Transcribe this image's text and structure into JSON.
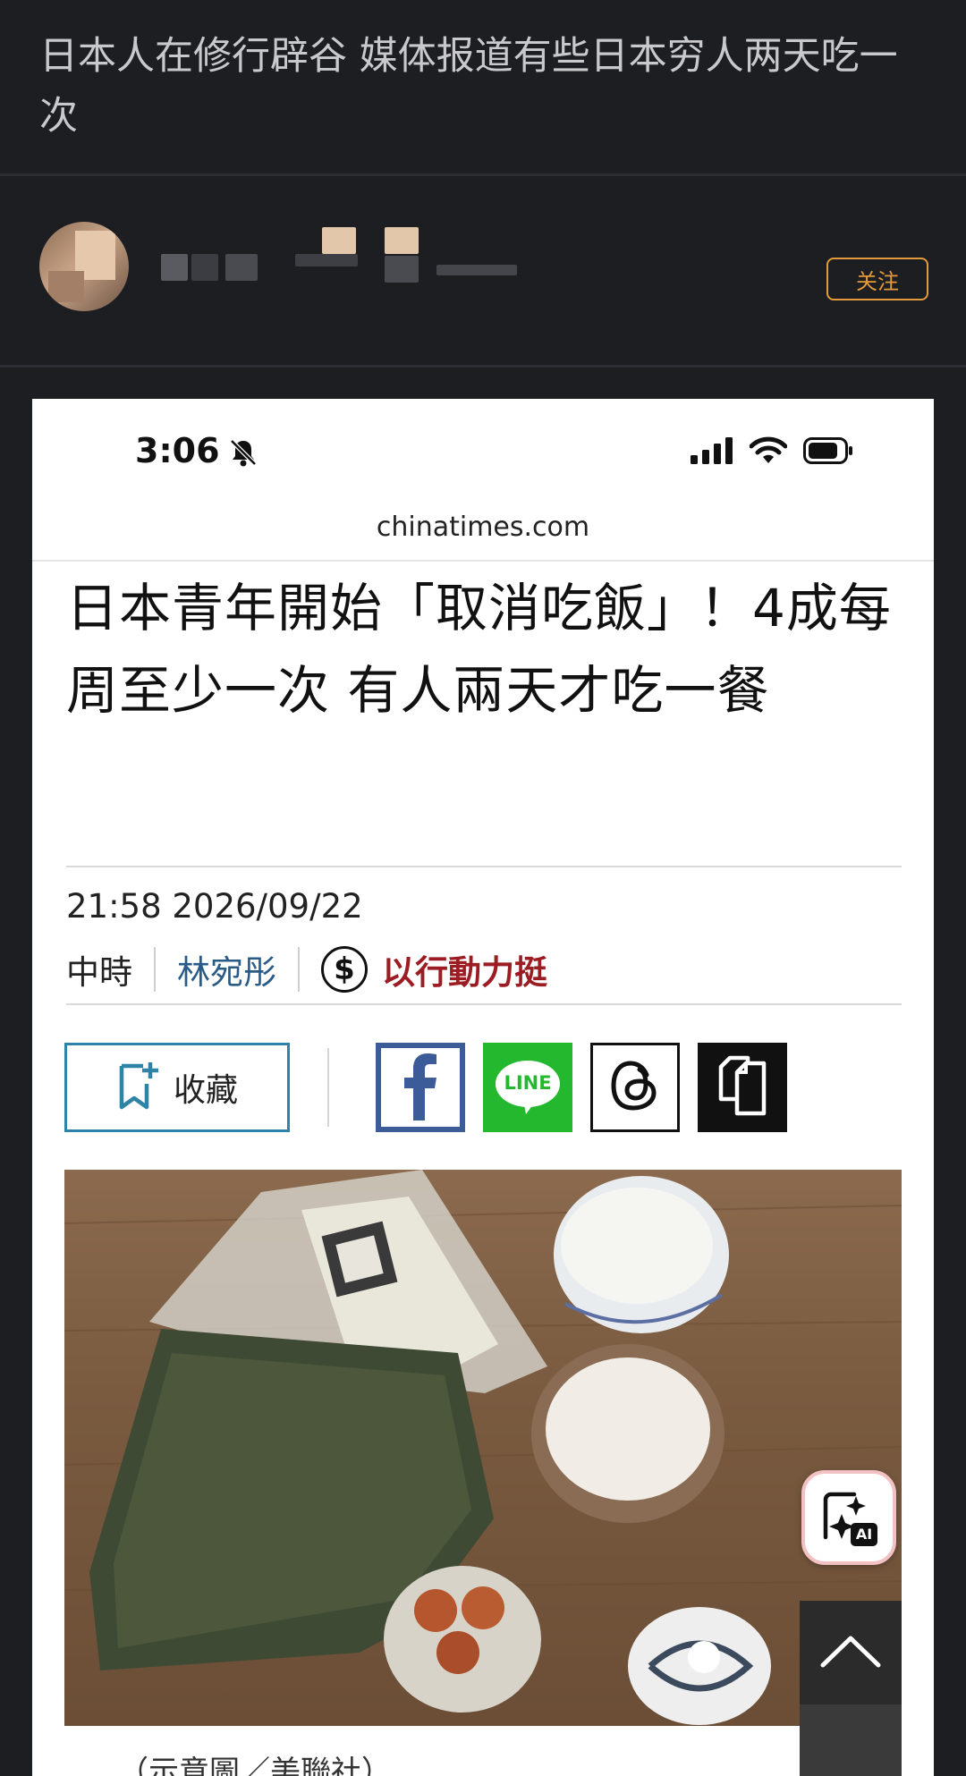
{
  "post": {
    "title": "日本人在修行辟谷 媒体报道有些日本穷人两天吃一次",
    "follow_label": "关注"
  },
  "screenshot": {
    "status_time": "3:06",
    "domain": "chinatimes.com",
    "headline": "日本青年開始「取消吃飯」！4成每周至少一次 有人兩天才吃一餐",
    "meta_time": "21:58  2026/09/22",
    "source": "中時",
    "author": "林宛彤",
    "action": "以行動力挺",
    "dollar_symbol": "$",
    "collect_label": "收藏",
    "line_label": "LINE",
    "ai_label": "AI",
    "caption": "（示意圖／美聯社）"
  },
  "colors": {
    "page_bg": "#1d1e22",
    "follow_accent": "#e39a3a",
    "author_blue": "#2a5a86",
    "action_red": "#9b1c22",
    "facebook": "#3b5c99",
    "line_green": "#24b82e",
    "collect_border": "#2f83a6"
  },
  "icons": [
    "bell-off-icon",
    "signal-icon",
    "wifi-icon",
    "battery-icon",
    "bookmark-plus-icon",
    "facebook-icon",
    "line-icon",
    "threads-icon",
    "copy-icon",
    "ai-sparkle-icon",
    "chevron-up-icon"
  ]
}
